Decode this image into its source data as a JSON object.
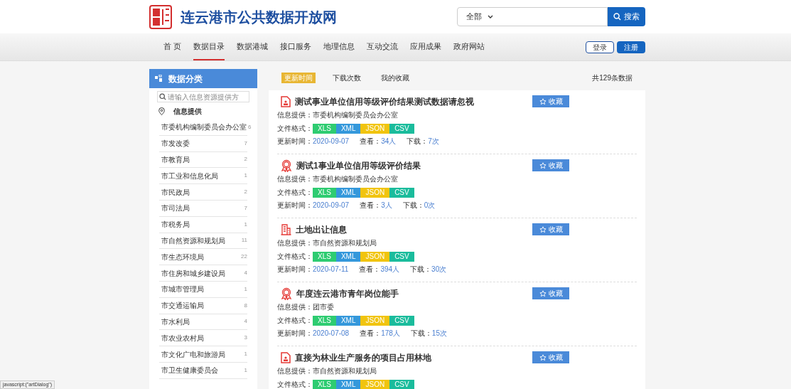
{
  "header": {
    "site_title": "连云港市公共数据开放网",
    "search": {
      "scope": "全部",
      "button": "搜索"
    }
  },
  "nav": {
    "items": [
      {
        "label": "首 页",
        "selected": false
      },
      {
        "label": "数据目录",
        "selected": true
      },
      {
        "label": "数据港城",
        "selected": false
      },
      {
        "label": "接口服务",
        "selected": false
      },
      {
        "label": "地理信息",
        "selected": false
      },
      {
        "label": "互动交流",
        "selected": false
      },
      {
        "label": "应用成果",
        "selected": false
      },
      {
        "label": "政府网站",
        "selected": false
      }
    ],
    "login": "登录",
    "register": "注册"
  },
  "sidebar": {
    "title": "数据分类",
    "search_placeholder": "请输入信息资源提供方",
    "section": "信息提供",
    "items": [
      {
        "name": "市委机构编制委员会办公室",
        "count": "6"
      },
      {
        "name": "市发改委",
        "count": "7"
      },
      {
        "name": "市教育局",
        "count": "2"
      },
      {
        "name": "市工业和信息化局",
        "count": "1"
      },
      {
        "name": "市民政局",
        "count": "2"
      },
      {
        "name": "市司法局",
        "count": "7"
      },
      {
        "name": "市税务局",
        "count": "1"
      },
      {
        "name": "市自然资源和规划局",
        "count": "11"
      },
      {
        "name": "市生态环境局",
        "count": "22"
      },
      {
        "name": "市住房和城乡建设局",
        "count": "4"
      },
      {
        "name": "市城市管理局",
        "count": "1"
      },
      {
        "name": "市交通运输局",
        "count": "8"
      },
      {
        "name": "市水利局",
        "count": "4"
      },
      {
        "name": "市农业农村局",
        "count": "3"
      },
      {
        "name": "市文化广电和旅游局",
        "count": "1"
      },
      {
        "name": "市卫生健康委员会",
        "count": "1"
      }
    ]
  },
  "sort_tabs": [
    {
      "label": "更新时间",
      "selected": true
    },
    {
      "label": "下载次数",
      "selected": false
    },
    {
      "label": "我的收藏",
      "selected": false
    }
  ],
  "total": "共129条数据",
  "datasets": [
    {
      "kind": "document",
      "title": "测试事业单位信用等级评价结果测试数据请忽视",
      "provider_label": "信息提供：",
      "provider": "市委机构编制委员会办公室",
      "formats_label": "文件格式：",
      "formats": [
        "XLS",
        "XML",
        "JSON",
        "CSV"
      ],
      "updated_label": "更新时间：",
      "updated": "2020-09-07",
      "views_label": "查看：",
      "views": "34人",
      "downloads_label": "下载：",
      "downloads": "7次",
      "favorite": "收藏"
    },
    {
      "kind": "award",
      "title": "测试1事业单位信用等级评价结果",
      "provider_label": "信息提供：",
      "provider": "市委机构编制委员会办公室",
      "formats_label": "文件格式：",
      "formats": [
        "XLS",
        "XML",
        "JSON",
        "CSV"
      ],
      "updated_label": "更新时间：",
      "updated": "2020-09-07",
      "views_label": "查看：",
      "views": "3人",
      "downloads_label": "下载：",
      "downloads": "0次",
      "favorite": "收藏"
    },
    {
      "kind": "building",
      "title": "土地出让信息",
      "provider_label": "信息提供：",
      "provider": "市自然资源和规划局",
      "formats_label": "文件格式：",
      "formats": [
        "XLS",
        "XML",
        "JSON",
        "CSV"
      ],
      "updated_label": "更新时间：",
      "updated": "2020-07-11",
      "views_label": "查看：",
      "views": "394人",
      "downloads_label": "下载：",
      "downloads": "30次",
      "favorite": "收藏"
    },
    {
      "kind": "award",
      "title": "年度连云港市青年岗位能手",
      "provider_label": "信息提供：",
      "provider": "团市委",
      "formats_label": "文件格式：",
      "formats": [
        "XLS",
        "XML",
        "JSON",
        "CSV"
      ],
      "updated_label": "更新时间：",
      "updated": "2020-07-08",
      "views_label": "查看：",
      "views": "178人",
      "downloads_label": "下载：",
      "downloads": "15次",
      "favorite": "收藏"
    },
    {
      "kind": "document",
      "title": "直接为林业生产服务的项目占用林地",
      "provider_label": "信息提供：",
      "provider": "市自然资源和规划局",
      "formats_label": "文件格式：",
      "formats": [
        "XLS",
        "XML",
        "JSON",
        "CSV"
      ],
      "favorite": "收藏"
    }
  ],
  "status_bar": "javascript:(\"artDialog\")"
}
